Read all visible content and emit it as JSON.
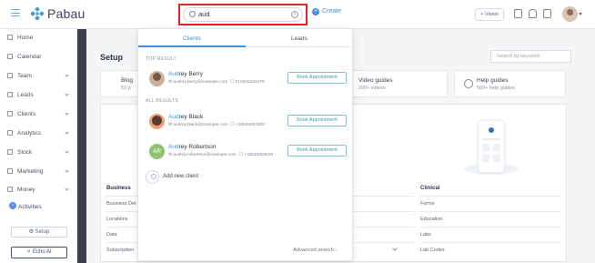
{
  "app": {
    "name": "Pabau"
  },
  "header": {
    "search_value": "aud",
    "create_label": "Create",
    "vision_label": "+ Vision"
  },
  "sidebar": {
    "items": [
      {
        "label": "Home"
      },
      {
        "label": "Calendar"
      },
      {
        "label": "Team"
      },
      {
        "label": "Leads"
      },
      {
        "label": "Clients"
      },
      {
        "label": "Analytics"
      },
      {
        "label": "Stock"
      },
      {
        "label": "Marketing"
      },
      {
        "label": "Money"
      },
      {
        "label": "Activities"
      }
    ],
    "setup_label": "Setup",
    "echo_label": "Echo AI"
  },
  "main": {
    "title": "Setup",
    "search_placeholder": "Search by keyword",
    "cards": [
      {
        "title": "Blog",
        "sub": "53 p"
      },
      {
        "title": "Video guides",
        "sub": "200+ videos"
      },
      {
        "title": "Help guides",
        "sub": "500+ help guides"
      }
    ],
    "business": {
      "heading": "Business",
      "rows": [
        "Business Det",
        "Locations",
        "Data",
        "Subscription"
      ]
    },
    "clinical": {
      "heading": "Clinical",
      "rows": [
        "Forms",
        "Education",
        "Labs",
        "Lab Codes"
      ]
    }
  },
  "dropdown": {
    "tabs": [
      "Clients",
      "Leads"
    ],
    "top_result_label": "TOP RESULT",
    "all_results_label": "ALL RESULTS",
    "book_label": "Book Appointment",
    "results": [
      {
        "highlight": "Aud",
        "rest": "rey Berry",
        "email": "audrey.berry@example.com",
        "phone": "010946334478"
      },
      {
        "highlight": "Aud",
        "rest": "rey Black",
        "email": "audrey.black@example.com",
        "phone": "+16046463900"
      },
      {
        "highlight": "Aud",
        "rest": "rey Robertson",
        "email": "audrey.robertson@example.com",
        "phone": "+15533366535",
        "initials": "AR"
      }
    ],
    "add_new": "Add new client",
    "advanced": "Advanced search"
  }
}
